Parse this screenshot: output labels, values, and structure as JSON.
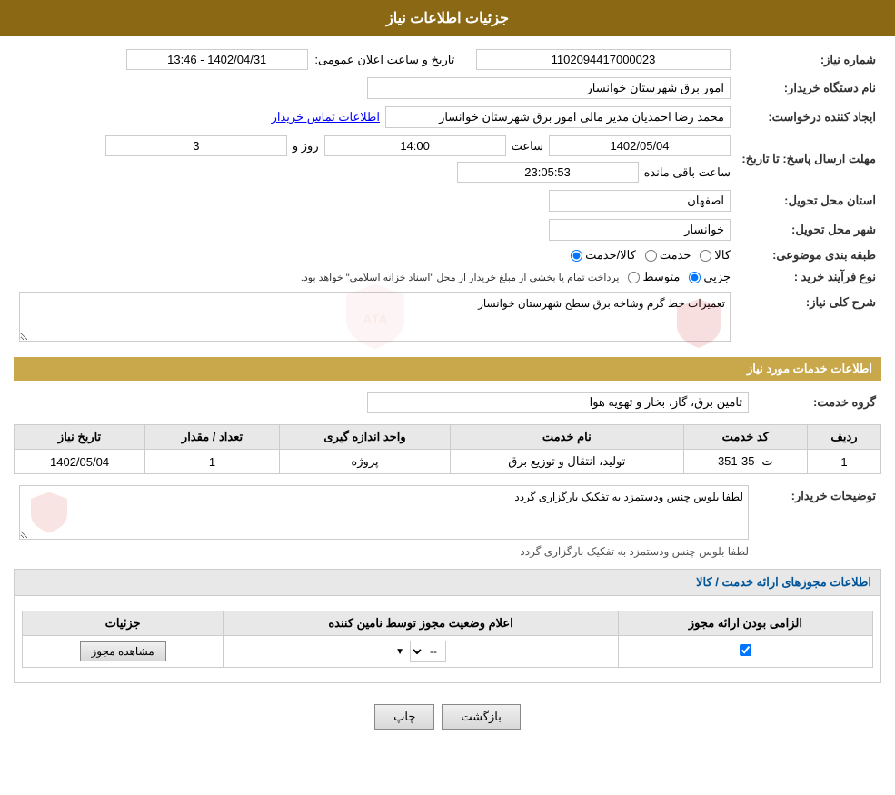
{
  "header": {
    "title": "جزئیات اطلاعات نیاز"
  },
  "fields": {
    "request_number_label": "شماره نیاز:",
    "request_number_value": "1102094417000023",
    "buyer_org_label": "نام دستگاه خریدار:",
    "buyer_org_value": "امور برق شهرستان خوانسار",
    "creator_label": "ایجاد کننده درخواست:",
    "creator_value": "محمد رضا احمدیان مدیر مالی امور برق شهرستان خوانسار",
    "contact_link": "اطلاعات تماس خریدار",
    "deadline_label": "مهلت ارسال پاسخ: تا تاریخ:",
    "deadline_date": "1402/05/04",
    "deadline_time_label": "ساعت",
    "deadline_time": "14:00",
    "deadline_days_label": "روز و",
    "deadline_days": "3",
    "deadline_remaining_label": "ساعت باقی مانده",
    "deadline_remaining": "23:05:53",
    "announce_label": "تاریخ و ساعت اعلان عمومی:",
    "announce_value": "1402/04/31 - 13:46",
    "province_label": "استان محل تحویل:",
    "province_value": "اصفهان",
    "city_label": "شهر محل تحویل:",
    "city_value": "خوانسار",
    "category_label": "طبقه بندی موضوعی:",
    "category_goods": "کالا",
    "category_service": "خدمت",
    "category_goods_service": "کالا/خدمت",
    "purchase_type_label": "نوع فرآیند خرید :",
    "purchase_type_partial": "جزیی",
    "purchase_type_medium": "متوسط",
    "purchase_type_note": "پرداخت تمام یا بخشی از مبلغ خریدار از محل \"اسناد خزانه اسلامی\" خواهد بود.",
    "description_label": "شرح کلی نیاز:",
    "description_value": "تعمیرات خط گرم وشاخه برق سطح شهرستان خوانسار"
  },
  "services_section": {
    "title": "اطلاعات خدمات مورد نیاز",
    "service_group_label": "گروه خدمت:",
    "service_group_value": "تامین برق، گاز، بخار و تهویه هوا",
    "table_headers": {
      "row_num": "ردیف",
      "service_code": "کد خدمت",
      "service_name": "نام خدمت",
      "unit": "واحد اندازه گیری",
      "quantity": "تعداد / مقدار",
      "date": "تاریخ نیاز"
    },
    "table_rows": [
      {
        "row_num": "1",
        "service_code": "ت -35-351",
        "service_name": "تولید، انتقال و توزیع برق",
        "unit": "پروژه",
        "quantity": "1",
        "date": "1402/05/04"
      }
    ],
    "buyer_notes_label": "توضیحات خریدار:",
    "buyer_notes_value": "لطفا بلوس چنس ودستمزد به تفکیک بارگزاری گردد"
  },
  "permits_section": {
    "title": "اطلاعات مجوزهای ارائه خدمت / کالا",
    "table_headers": {
      "mandatory": "الزامی بودن ارائه مجوز",
      "status": "اعلام وضعیت مجوز توسط نامین کننده",
      "details": "جزئیات"
    },
    "table_rows": [
      {
        "mandatory": true,
        "status_value": "--",
        "details_label": "مشاهده مجوز"
      }
    ]
  },
  "buttons": {
    "print": "چاپ",
    "back": "بازگشت"
  }
}
